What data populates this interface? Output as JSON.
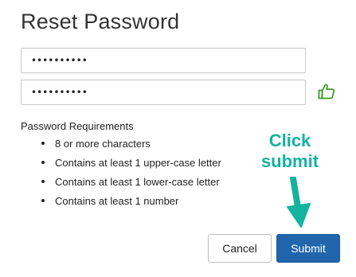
{
  "page": {
    "title": "Reset Password"
  },
  "fields": {
    "new_password_mask": "••••••••••",
    "confirm_password_mask": "••••••••••",
    "match_icon": "thumbs-up-icon"
  },
  "requirements": {
    "heading": "Password Requirements",
    "items": [
      "8 or more characters",
      "Contains at least 1 upper-case letter",
      "Contains at least 1 lower-case letter",
      "Contains at least 1 number"
    ]
  },
  "annotation": {
    "line1": "Click",
    "line2": "submit",
    "color": "#14b3a0",
    "arrow_icon": "down-arrow-icon"
  },
  "buttons": {
    "cancel_label": "Cancel",
    "submit_label": "Submit",
    "submit_color": "#2166ad"
  }
}
